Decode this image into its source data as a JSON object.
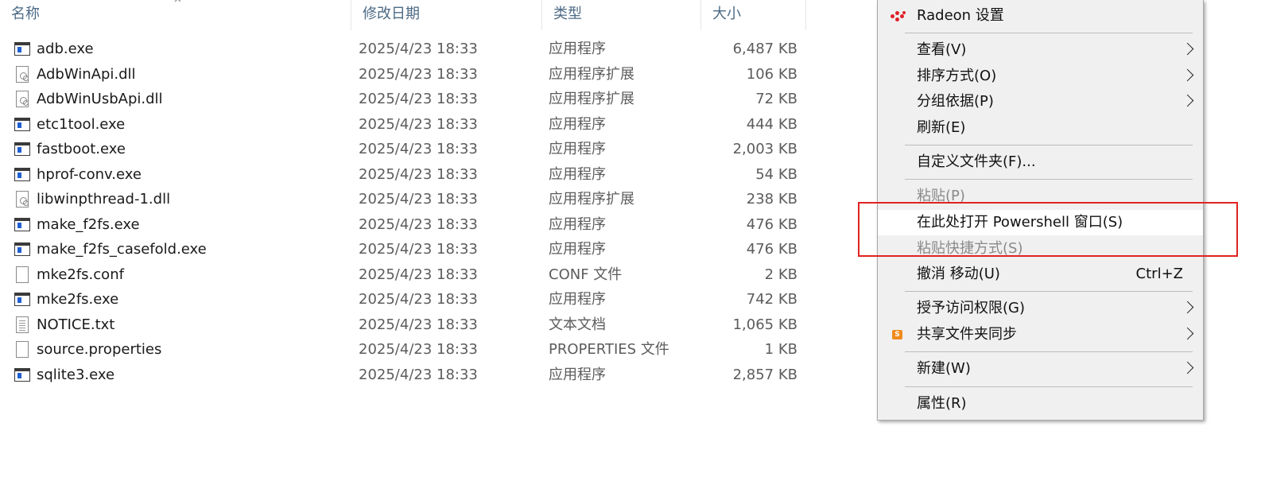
{
  "columns": {
    "name": "名称",
    "modified": "修改日期",
    "type": "类型",
    "size": "大小"
  },
  "files": [
    {
      "name": "adb.exe",
      "date": "2025/4/23 18:33",
      "type": "应用程序",
      "size": "6,487 KB",
      "icon": "exe-icon"
    },
    {
      "name": "AdbWinApi.dll",
      "date": "2025/4/23 18:33",
      "type": "应用程序扩展",
      "size": "106 KB",
      "icon": "dll-icon"
    },
    {
      "name": "AdbWinUsbApi.dll",
      "date": "2025/4/23 18:33",
      "type": "应用程序扩展",
      "size": "72 KB",
      "icon": "dll-icon"
    },
    {
      "name": "etc1tool.exe",
      "date": "2025/4/23 18:33",
      "type": "应用程序",
      "size": "444 KB",
      "icon": "exe-icon"
    },
    {
      "name": "fastboot.exe",
      "date": "2025/4/23 18:33",
      "type": "应用程序",
      "size": "2,003 KB",
      "icon": "exe-icon"
    },
    {
      "name": "hprof-conv.exe",
      "date": "2025/4/23 18:33",
      "type": "应用程序",
      "size": "54 KB",
      "icon": "exe-icon"
    },
    {
      "name": "libwinpthread-1.dll",
      "date": "2025/4/23 18:33",
      "type": "应用程序扩展",
      "size": "238 KB",
      "icon": "dll-icon"
    },
    {
      "name": "make_f2fs.exe",
      "date": "2025/4/23 18:33",
      "type": "应用程序",
      "size": "476 KB",
      "icon": "exe-icon"
    },
    {
      "name": "make_f2fs_casefold.exe",
      "date": "2025/4/23 18:33",
      "type": "应用程序",
      "size": "476 KB",
      "icon": "exe-icon"
    },
    {
      "name": "mke2fs.conf",
      "date": "2025/4/23 18:33",
      "type": "CONF 文件",
      "size": "2 KB",
      "icon": "blank-file-icon"
    },
    {
      "name": "mke2fs.exe",
      "date": "2025/4/23 18:33",
      "type": "应用程序",
      "size": "742 KB",
      "icon": "exe-icon"
    },
    {
      "name": "NOTICE.txt",
      "date": "2025/4/23 18:33",
      "type": "文本文档",
      "size": "1,065 KB",
      "icon": "text-file-icon"
    },
    {
      "name": "source.properties",
      "date": "2025/4/23 18:33",
      "type": "PROPERTIES 文件",
      "size": "1 KB",
      "icon": "blank-file-icon"
    },
    {
      "name": "sqlite3.exe",
      "date": "2025/4/23 18:33",
      "type": "应用程序",
      "size": "2,857 KB",
      "icon": "exe-icon"
    }
  ],
  "context_menu": {
    "radeon": "Radeon 设置",
    "view": "查看(V)",
    "sort_by": "排序方式(O)",
    "group_by": "分组依据(P)",
    "refresh": "刷新(E)",
    "customize": "自定义文件夹(F)...",
    "paste": "粘贴(P)",
    "open_powershell": "在此处打开 Powershell 窗口(S)",
    "paste_shortcut": "粘贴快捷方式(S)",
    "undo_move": "撤消 移动(U)",
    "undo_shortcut": "Ctrl+Z",
    "give_access": "授予访问权限(G)",
    "share_sync": "共享文件夹同步",
    "share_icon_letter": "S",
    "new": "新建(W)",
    "properties": "属性(R)"
  },
  "colors": {
    "accent_blue": "#1f5fd1",
    "header_text": "#4d6a85",
    "annotation_red": "#e02323",
    "radeon_red": "#e0202a",
    "share_orange": "#f08a1c"
  }
}
